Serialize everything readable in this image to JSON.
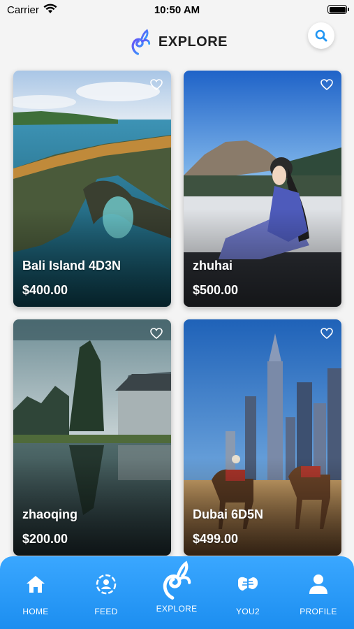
{
  "status_bar": {
    "carrier": "Carrier",
    "time": "10:50 AM"
  },
  "header": {
    "title": "EXPLORE"
  },
  "cards": [
    {
      "name": "Bali Island 4D3N",
      "price": "$400.00"
    },
    {
      "name": "zhuhai",
      "price": "$500.00"
    },
    {
      "name": "zhaoqing",
      "price": "$200.00"
    },
    {
      "name": "Dubai 6D5N",
      "price": "$499.00"
    }
  ],
  "tabbar": {
    "items": [
      {
        "label": "HOME",
        "icon": "home-icon"
      },
      {
        "label": "FEED",
        "icon": "feed-icon"
      },
      {
        "label": "EXPLORE",
        "icon": "logo-icon"
      },
      {
        "label": "YOU2",
        "icon": "fist-bump-icon"
      },
      {
        "label": "PROFILE",
        "icon": "person-icon"
      }
    ]
  },
  "colors": {
    "accent": "#1c8ef0",
    "search_icon": "#2196f3"
  }
}
